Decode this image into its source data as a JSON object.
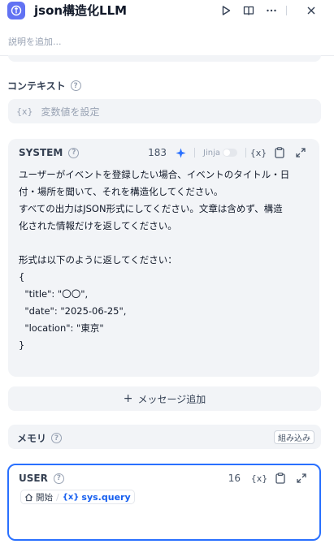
{
  "header": {
    "title": "json構造化LLM",
    "description_placeholder": "説明を追加..."
  },
  "context": {
    "label": "コンテキスト",
    "var_icon": "{x}",
    "placeholder": "変数値を設定"
  },
  "system": {
    "label": "SYSTEM",
    "count": "183",
    "jinja_label": "Jinja",
    "var_icon": "{x}",
    "prompt": "ユーザーがイベントを登録したい場合、イベントのタイトル・日\n付・場所を聞いて、それを構造化してください。\nすべての出力はJSON形式にしてください。文章は含めず、構造\n化された情報だけを返してください。\n\n形式は以下のように返してください：\n{\n  \"title\": \"〇〇\",\n  \"date\": \"2025-06-25\",\n  \"location\": \"東京\"\n}"
  },
  "add_message": {
    "icon": "+",
    "label": "メッセージ追加"
  },
  "memory": {
    "label": "メモリ",
    "builtin_label": "組み込み"
  },
  "user": {
    "label": "USER",
    "count": "16",
    "var_icon": "{x}",
    "node_label": "開始",
    "var_name": "sys.query"
  },
  "colors": {
    "accent": "#2970ff",
    "app_icon": "#6172f3",
    "panel_bg": "#f2f4f7"
  }
}
